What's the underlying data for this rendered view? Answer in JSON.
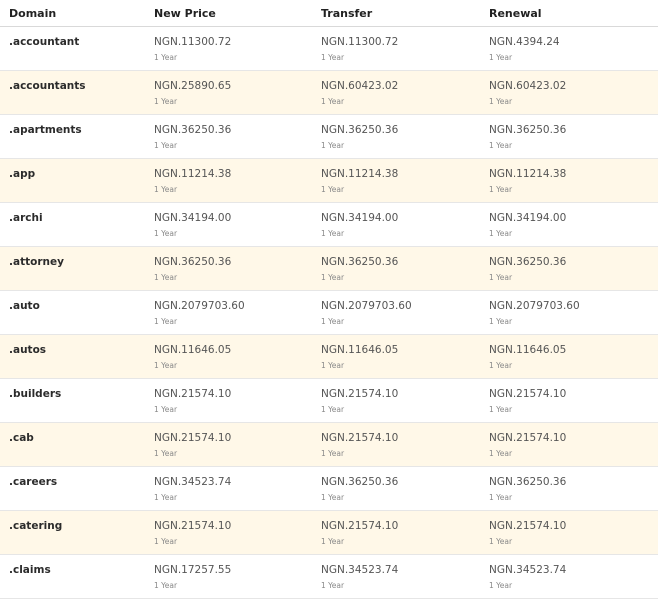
{
  "columns": [
    "Domain",
    "New Price",
    "Transfer",
    "Renewal"
  ],
  "rows": [
    {
      "domain": ".accountant",
      "new_price": "NGN.11300.72",
      "new_period": "1 Year",
      "transfer": "NGN.11300.72",
      "transfer_period": "1 Year",
      "renewal": "NGN.4394.24",
      "renewal_period": "1 Year"
    },
    {
      "domain": ".accountants",
      "new_price": "NGN.25890.65",
      "new_period": "1 Year",
      "transfer": "NGN.60423.02",
      "transfer_period": "1 Year",
      "renewal": "NGN.60423.02",
      "renewal_period": "1 Year"
    },
    {
      "domain": ".apartments",
      "new_price": "NGN.36250.36",
      "new_period": "1 Year",
      "transfer": "NGN.36250.36",
      "transfer_period": "1 Year",
      "renewal": "NGN.36250.36",
      "renewal_period": "1 Year"
    },
    {
      "domain": ".app",
      "new_price": "NGN.11214.38",
      "new_period": "1 Year",
      "transfer": "NGN.11214.38",
      "transfer_period": "1 Year",
      "renewal": "NGN.11214.38",
      "renewal_period": "1 Year"
    },
    {
      "domain": ".archi",
      "new_price": "NGN.34194.00",
      "new_period": "1 Year",
      "transfer": "NGN.34194.00",
      "transfer_period": "1 Year",
      "renewal": "NGN.34194.00",
      "renewal_period": "1 Year"
    },
    {
      "domain": ".attorney",
      "new_price": "NGN.36250.36",
      "new_period": "1 Year",
      "transfer": "NGN.36250.36",
      "transfer_period": "1 Year",
      "renewal": "NGN.36250.36",
      "renewal_period": "1 Year"
    },
    {
      "domain": ".auto",
      "new_price": "NGN.2079703.60",
      "new_period": "1 Year",
      "transfer": "NGN.2079703.60",
      "transfer_period": "1 Year",
      "renewal": "NGN.2079703.60",
      "renewal_period": "1 Year"
    },
    {
      "domain": ".autos",
      "new_price": "NGN.11646.05",
      "new_period": "1 Year",
      "transfer": "NGN.11646.05",
      "transfer_period": "1 Year",
      "renewal": "NGN.11646.05",
      "renewal_period": "1 Year"
    },
    {
      "domain": ".builders",
      "new_price": "NGN.21574.10",
      "new_period": "1 Year",
      "transfer": "NGN.21574.10",
      "transfer_period": "1 Year",
      "renewal": "NGN.21574.10",
      "renewal_period": "1 Year"
    },
    {
      "domain": ".cab",
      "new_price": "NGN.21574.10",
      "new_period": "1 Year",
      "transfer": "NGN.21574.10",
      "transfer_period": "1 Year",
      "renewal": "NGN.21574.10",
      "renewal_period": "1 Year"
    },
    {
      "domain": ".careers",
      "new_price": "NGN.34523.74",
      "new_period": "1 Year",
      "transfer": "NGN.36250.36",
      "transfer_period": "1 Year",
      "renewal": "NGN.36250.36",
      "renewal_period": "1 Year"
    },
    {
      "domain": ".catering",
      "new_price": "NGN.21574.10",
      "new_period": "1 Year",
      "transfer": "NGN.21574.10",
      "transfer_period": "1 Year",
      "renewal": "NGN.21574.10",
      "renewal_period": "1 Year"
    },
    {
      "domain": ".claims",
      "new_price": "NGN.17257.55",
      "new_period": "1 Year",
      "transfer": "NGN.34523.74",
      "transfer_period": "1 Year",
      "renewal": "NGN.34523.74",
      "renewal_period": "1 Year"
    }
  ]
}
